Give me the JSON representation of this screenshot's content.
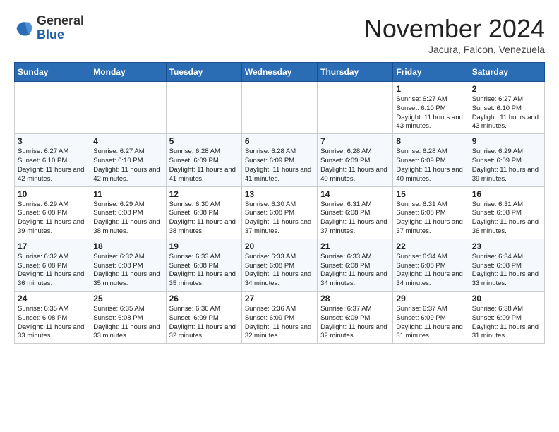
{
  "header": {
    "logo": {
      "general": "General",
      "blue": "Blue"
    },
    "title": "November 2024",
    "location": "Jacura, Falcon, Venezuela"
  },
  "weekdays": [
    "Sunday",
    "Monday",
    "Tuesday",
    "Wednesday",
    "Thursday",
    "Friday",
    "Saturday"
  ],
  "weeks": [
    [
      {
        "day": "",
        "info": ""
      },
      {
        "day": "",
        "info": ""
      },
      {
        "day": "",
        "info": ""
      },
      {
        "day": "",
        "info": ""
      },
      {
        "day": "",
        "info": ""
      },
      {
        "day": "1",
        "info": "Sunrise: 6:27 AM\nSunset: 6:10 PM\nDaylight: 11 hours and 43 minutes."
      },
      {
        "day": "2",
        "info": "Sunrise: 6:27 AM\nSunset: 6:10 PM\nDaylight: 11 hours and 43 minutes."
      }
    ],
    [
      {
        "day": "3",
        "info": "Sunrise: 6:27 AM\nSunset: 6:10 PM\nDaylight: 11 hours and 42 minutes."
      },
      {
        "day": "4",
        "info": "Sunrise: 6:27 AM\nSunset: 6:10 PM\nDaylight: 11 hours and 42 minutes."
      },
      {
        "day": "5",
        "info": "Sunrise: 6:28 AM\nSunset: 6:09 PM\nDaylight: 11 hours and 41 minutes."
      },
      {
        "day": "6",
        "info": "Sunrise: 6:28 AM\nSunset: 6:09 PM\nDaylight: 11 hours and 41 minutes."
      },
      {
        "day": "7",
        "info": "Sunrise: 6:28 AM\nSunset: 6:09 PM\nDaylight: 11 hours and 40 minutes."
      },
      {
        "day": "8",
        "info": "Sunrise: 6:28 AM\nSunset: 6:09 PM\nDaylight: 11 hours and 40 minutes."
      },
      {
        "day": "9",
        "info": "Sunrise: 6:29 AM\nSunset: 6:09 PM\nDaylight: 11 hours and 39 minutes."
      }
    ],
    [
      {
        "day": "10",
        "info": "Sunrise: 6:29 AM\nSunset: 6:08 PM\nDaylight: 11 hours and 39 minutes."
      },
      {
        "day": "11",
        "info": "Sunrise: 6:29 AM\nSunset: 6:08 PM\nDaylight: 11 hours and 38 minutes."
      },
      {
        "day": "12",
        "info": "Sunrise: 6:30 AM\nSunset: 6:08 PM\nDaylight: 11 hours and 38 minutes."
      },
      {
        "day": "13",
        "info": "Sunrise: 6:30 AM\nSunset: 6:08 PM\nDaylight: 11 hours and 37 minutes."
      },
      {
        "day": "14",
        "info": "Sunrise: 6:31 AM\nSunset: 6:08 PM\nDaylight: 11 hours and 37 minutes."
      },
      {
        "day": "15",
        "info": "Sunrise: 6:31 AM\nSunset: 6:08 PM\nDaylight: 11 hours and 37 minutes."
      },
      {
        "day": "16",
        "info": "Sunrise: 6:31 AM\nSunset: 6:08 PM\nDaylight: 11 hours and 36 minutes."
      }
    ],
    [
      {
        "day": "17",
        "info": "Sunrise: 6:32 AM\nSunset: 6:08 PM\nDaylight: 11 hours and 36 minutes."
      },
      {
        "day": "18",
        "info": "Sunrise: 6:32 AM\nSunset: 6:08 PM\nDaylight: 11 hours and 35 minutes."
      },
      {
        "day": "19",
        "info": "Sunrise: 6:33 AM\nSunset: 6:08 PM\nDaylight: 11 hours and 35 minutes."
      },
      {
        "day": "20",
        "info": "Sunrise: 6:33 AM\nSunset: 6:08 PM\nDaylight: 11 hours and 34 minutes."
      },
      {
        "day": "21",
        "info": "Sunrise: 6:33 AM\nSunset: 6:08 PM\nDaylight: 11 hours and 34 minutes."
      },
      {
        "day": "22",
        "info": "Sunrise: 6:34 AM\nSunset: 6:08 PM\nDaylight: 11 hours and 34 minutes."
      },
      {
        "day": "23",
        "info": "Sunrise: 6:34 AM\nSunset: 6:08 PM\nDaylight: 11 hours and 33 minutes."
      }
    ],
    [
      {
        "day": "24",
        "info": "Sunrise: 6:35 AM\nSunset: 6:08 PM\nDaylight: 11 hours and 33 minutes."
      },
      {
        "day": "25",
        "info": "Sunrise: 6:35 AM\nSunset: 6:08 PM\nDaylight: 11 hours and 33 minutes."
      },
      {
        "day": "26",
        "info": "Sunrise: 6:36 AM\nSunset: 6:09 PM\nDaylight: 11 hours and 32 minutes."
      },
      {
        "day": "27",
        "info": "Sunrise: 6:36 AM\nSunset: 6:09 PM\nDaylight: 11 hours and 32 minutes."
      },
      {
        "day": "28",
        "info": "Sunrise: 6:37 AM\nSunset: 6:09 PM\nDaylight: 11 hours and 32 minutes."
      },
      {
        "day": "29",
        "info": "Sunrise: 6:37 AM\nSunset: 6:09 PM\nDaylight: 11 hours and 31 minutes."
      },
      {
        "day": "30",
        "info": "Sunrise: 6:38 AM\nSunset: 6:09 PM\nDaylight: 11 hours and 31 minutes."
      }
    ]
  ]
}
